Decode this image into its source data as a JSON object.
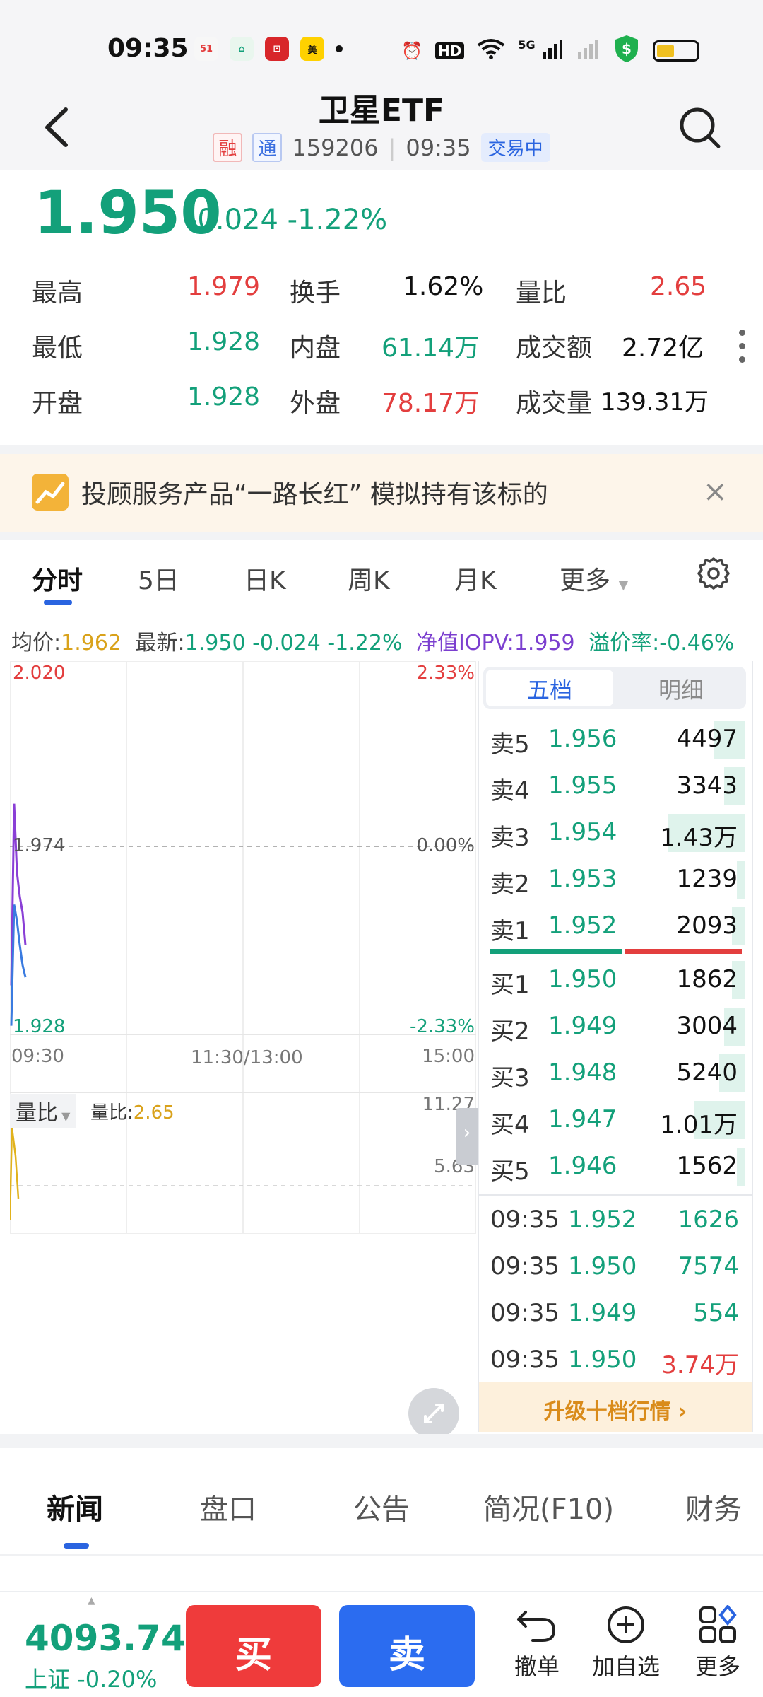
{
  "status_bar": {
    "time": "09:35",
    "network": "5G",
    "hd_label": "HD"
  },
  "header": {
    "title": "卫星ETF",
    "tag_margin": "融",
    "tag_connect": "通",
    "code": "159206",
    "time": "09:35",
    "trading_status": "交易中"
  },
  "quote": {
    "price": "1.950",
    "change": "-0.024",
    "change_pct": "-1.22%",
    "stats": {
      "high_label": "最高",
      "high": "1.979",
      "turnover_label": "换手",
      "turnover": "1.62%",
      "vol_ratio_label": "量比",
      "vol_ratio": "2.65",
      "low_label": "最低",
      "low": "1.928",
      "inner_label": "内盘",
      "inner": "61.14万",
      "amount_label": "成交额",
      "amount": "2.72亿",
      "open_label": "开盘",
      "open": "1.928",
      "outer_label": "外盘",
      "outer": "78.17万",
      "volume_label": "成交量",
      "volume": "139.31万"
    }
  },
  "banner": {
    "text": "投顾服务产品“一路长红” 模拟持有该标的",
    "close": "×"
  },
  "period_tabs": [
    "分时",
    "5日",
    "日K",
    "周K",
    "月K",
    "更多"
  ],
  "info_line": {
    "avg_label": "均价:",
    "avg": "1.962",
    "latest_label": "最新:",
    "latest": "1.950 -0.024 -1.22%",
    "iopv_label": "净值IOPV:",
    "iopv": "1.959",
    "premium_label": "溢价率:",
    "premium": "-0.46%"
  },
  "chart": {
    "y_top": "2.020",
    "y_mid": "1.974",
    "y_bottom": "1.928",
    "pct_top": "2.33%",
    "pct_mid": "0.00%",
    "pct_bottom": "-2.33%",
    "x_start": "09:30",
    "x_mid": "11:30/13:00",
    "x_end": "15:00",
    "vr_label": "量比",
    "vr_value_label": "量比:",
    "vr_value": "2.65",
    "vr_top": "11.27",
    "vr_mid": "5.63"
  },
  "chart_data": {
    "type": "line",
    "x": [
      "09:30",
      "09:31",
      "09:32",
      "09:33",
      "09:34",
      "09:35"
    ],
    "series": [
      {
        "values": [
          1.94,
          1.985,
          1.968,
          1.962,
          1.958,
          1.95
        ]
      },
      {
        "values": [
          1.93,
          1.96,
          1.956,
          1.95,
          1.945,
          1.942
        ]
      }
    ],
    "ylim": [
      1.928,
      2.02
    ]
  },
  "order_book": {
    "tab_five": "五档",
    "tab_detail": "明细",
    "asks": [
      {
        "label": "卖5",
        "price": "1.956",
        "vol": "4497",
        "depth": 0.12
      },
      {
        "label": "卖4",
        "price": "1.955",
        "vol": "3343",
        "depth": 0.08
      },
      {
        "label": "卖3",
        "price": "1.954",
        "vol": "1.43万",
        "depth": 0.3
      },
      {
        "label": "卖2",
        "price": "1.953",
        "vol": "1239",
        "depth": 0.03
      },
      {
        "label": "卖1",
        "price": "1.952",
        "vol": "2093",
        "depth": 0.05
      }
    ],
    "bids": [
      {
        "label": "买1",
        "price": "1.950",
        "vol": "1862",
        "depth": 0.05
      },
      {
        "label": "买2",
        "price": "1.949",
        "vol": "3004",
        "depth": 0.08
      },
      {
        "label": "买3",
        "price": "1.948",
        "vol": "5240",
        "depth": 0.1
      },
      {
        "label": "买4",
        "price": "1.947",
        "vol": "1.01万",
        "depth": 0.2
      },
      {
        "label": "买5",
        "price": "1.946",
        "vol": "1562",
        "depth": 0.03
      }
    ],
    "ticks": [
      {
        "time": "09:35",
        "price": "1.952",
        "vol": "1626",
        "side": "green"
      },
      {
        "time": "09:35",
        "price": "1.950",
        "vol": "7574",
        "side": "green"
      },
      {
        "time": "09:35",
        "price": "1.949",
        "vol": "554",
        "side": "green"
      },
      {
        "time": "09:35",
        "price": "1.950",
        "vol": "3.74万",
        "side": "red"
      }
    ],
    "upgrade": "升级十档行情 ›"
  },
  "section_tabs": [
    "新闻",
    "盘口",
    "公告",
    "简况(F10)",
    "财务"
  ],
  "bottom_bar": {
    "index_value": "4093.74",
    "index_name": "上证 -0.20%",
    "buy": "买",
    "sell": "卖",
    "cancel": "撤单",
    "add_watch": "加自选",
    "more": "更多"
  },
  "colors": {
    "down": "#13a07a",
    "up": "#e33e3e",
    "accent": "#2a64e0",
    "iopv": "#7b3fcf"
  }
}
